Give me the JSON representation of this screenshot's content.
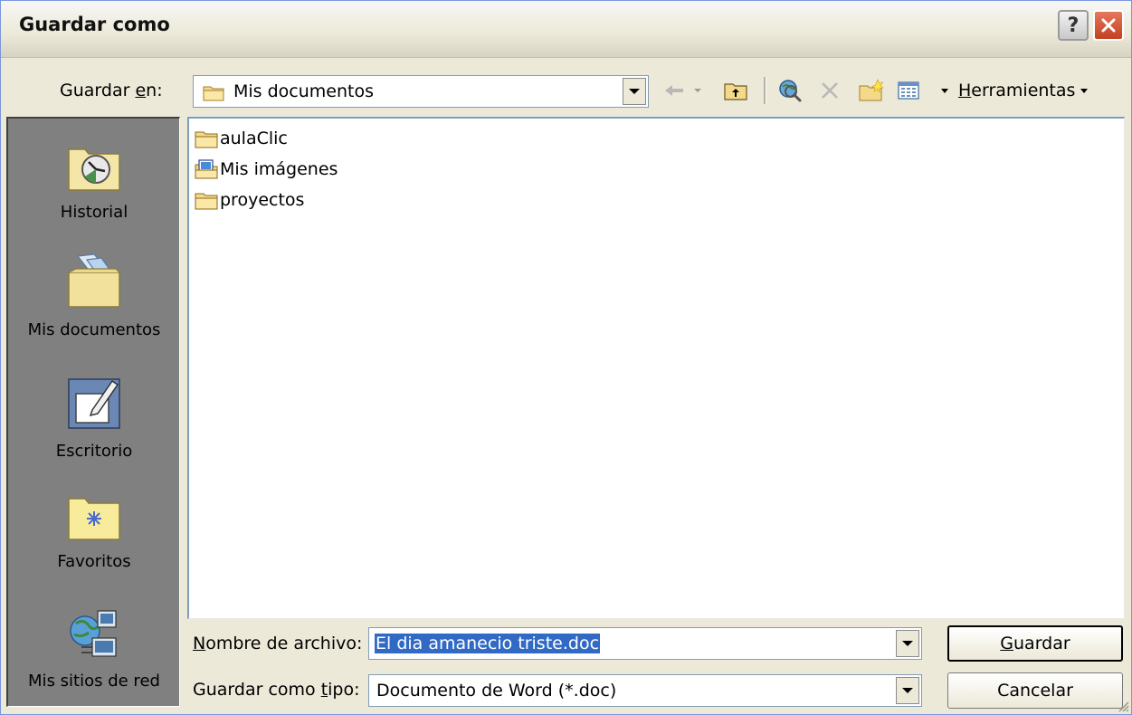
{
  "window": {
    "title": "Guardar como"
  },
  "title_buttons": {
    "help": "?"
  },
  "toolbar": {
    "save_in_label_prefix": "Guardar ",
    "save_in_label_key": "e",
    "save_in_label_suffix": "n:",
    "location": "Mis documentos",
    "tools_key": "H",
    "tools_rest": "erramientas"
  },
  "places": [
    {
      "label": "Historial",
      "icon": "history-icon"
    },
    {
      "label": "Mis documentos",
      "icon": "my-documents-icon"
    },
    {
      "label": "Escritorio",
      "icon": "desktop-icon"
    },
    {
      "label": "Favoritos",
      "icon": "favorites-icon"
    },
    {
      "label": "Mis sitios de red",
      "icon": "network-places-icon"
    }
  ],
  "files": [
    {
      "name": "aulaClic",
      "icon": "folder-icon"
    },
    {
      "name": "Mis imágenes",
      "icon": "pictures-folder-icon"
    },
    {
      "name": "proyectos",
      "icon": "folder-icon"
    }
  ],
  "filename": {
    "label_key": "N",
    "label_rest": "ombre de archivo:",
    "value": "El dia amanecio triste.doc"
  },
  "filetype": {
    "label_prefix": "Guardar como ",
    "label_key": "t",
    "label_rest": "ipo:",
    "value": "Documento de Word (*.doc)"
  },
  "buttons": {
    "save_key": "G",
    "save_rest": "uardar",
    "cancel": "Cancelar"
  }
}
